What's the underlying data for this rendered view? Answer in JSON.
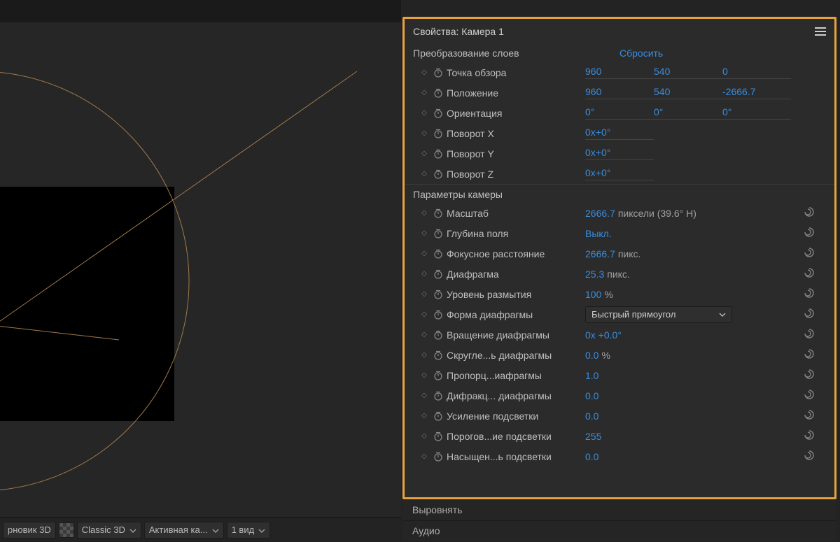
{
  "panel": {
    "title": "Свойства: Камера 1"
  },
  "transform": {
    "section_title": "Преобразование слоев",
    "reset": "Сбросить",
    "rows": [
      {
        "label": "Точка обзора",
        "v": [
          "960",
          "540",
          "0"
        ]
      },
      {
        "label": "Положение",
        "v": [
          "960",
          "540",
          "-2666.7"
        ]
      },
      {
        "label": "Ориентация",
        "v": [
          "0°",
          "0°",
          "0°"
        ]
      },
      {
        "label": "Поворот X",
        "singleton": "0x+0°"
      },
      {
        "label": "Поворот Y",
        "singleton": "0x+0°"
      },
      {
        "label": "Поворот Z",
        "singleton": "0x+0°"
      }
    ]
  },
  "camera": {
    "section_title": "Параметры камеры",
    "rows": [
      {
        "label": "Масштаб",
        "value": "2666.7",
        "unit": "пиксели (39.6° H)",
        "swirl": true
      },
      {
        "label": "Глубина поля",
        "value": "Выкл.",
        "unit": "",
        "swirl": true
      },
      {
        "label": "Фокусное расстояние",
        "value": "2666.7",
        "unit": "пикс.",
        "swirl": true
      },
      {
        "label": "Диафрагма",
        "value": "25.3",
        "unit": "пикс.",
        "swirl": true
      },
      {
        "label": "Уровень размытия",
        "value": "100",
        "unit": "%",
        "swirl": true
      },
      {
        "label": "Форма диафрагмы",
        "dropdown": "Быстрый прямоугол",
        "swirl": true
      },
      {
        "label": "Вращение диафрагмы",
        "value": "0x +0.0°",
        "unit": "",
        "swirl": true
      },
      {
        "label": "Скругле...ь диафрагмы",
        "value": "0.0",
        "unit": "%",
        "swirl": true
      },
      {
        "label": "Пропорц...иафрагмы",
        "value": "1.0",
        "unit": "",
        "swirl": true
      },
      {
        "label": "Дифракц... диафрагмы",
        "value": "0.0",
        "unit": "",
        "swirl": true
      },
      {
        "label": "Усиление подсветки",
        "value": "0.0",
        "unit": "",
        "swirl": true
      },
      {
        "label": "Порогов...ие подсветки",
        "value": "255",
        "unit": "",
        "swirl": true
      },
      {
        "label": "Насыщен...ь подсветки",
        "value": "0.0",
        "unit": "",
        "swirl": true
      }
    ]
  },
  "lower_tabs": {
    "align": "Выровнять",
    "audio": "Аудио"
  },
  "footer": {
    "draft3d": "рновик 3D",
    "renderer": "Classic 3D",
    "camera": "Активная ка...",
    "views": "1 вид"
  }
}
